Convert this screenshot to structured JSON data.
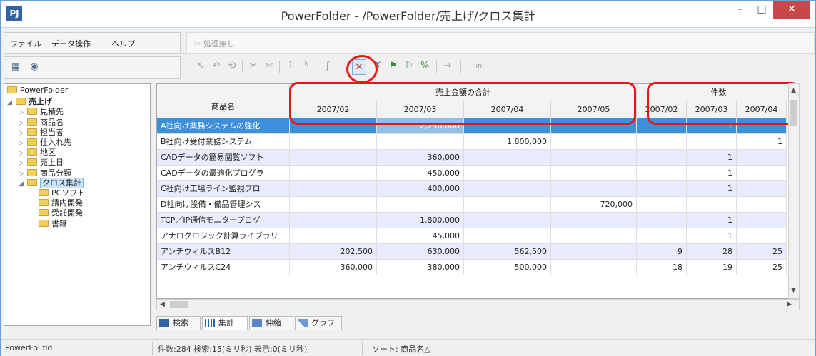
{
  "window": {
    "app_icon": "PJ",
    "title": "PowerFolder - /PowerFolder/売上げ/クロス集計",
    "min_glyph": "–",
    "max_glyph": "□",
    "close_glyph": "✕"
  },
  "menu": {
    "items": [
      "ファイル",
      "データ操作",
      "ヘルプ"
    ],
    "command_label": "処理無し"
  },
  "toolbar": {
    "left_icons": [
      "view-grid-icon",
      "eye-icon"
    ],
    "right_label": "ini"
  },
  "tree": {
    "nodes": [
      {
        "label": "PowerFolder",
        "level": 0,
        "arrow": ""
      },
      {
        "label": "売上げ",
        "level": 0,
        "arrow": "expanded",
        "bold": true
      },
      {
        "label": "見積先",
        "level": 1,
        "arrow": "collapsed"
      },
      {
        "label": "商品名",
        "level": 1,
        "arrow": "collapsed"
      },
      {
        "label": "担当者",
        "level": 1,
        "arrow": "collapsed"
      },
      {
        "label": "仕入れ先",
        "level": 1,
        "arrow": "collapsed"
      },
      {
        "label": "地区",
        "level": 1,
        "arrow": "collapsed"
      },
      {
        "label": "売上日",
        "level": 1,
        "arrow": "collapsed"
      },
      {
        "label": "商品分類",
        "level": 1,
        "arrow": "collapsed"
      },
      {
        "label": "クロス集計",
        "level": 1,
        "arrow": "expanded",
        "selected": true
      },
      {
        "label": "PCソフト",
        "level": 2,
        "arrow": ""
      },
      {
        "label": "請内開発",
        "level": 2,
        "arrow": ""
      },
      {
        "label": "受託開発",
        "level": 2,
        "arrow": ""
      },
      {
        "label": "書籍",
        "level": 2,
        "arrow": ""
      }
    ]
  },
  "grid": {
    "row_header_title": "商品名",
    "group_headers": [
      "売上金額の合計",
      "件数"
    ],
    "month_headers": [
      "2007/02",
      "2007/03",
      "2007/04",
      "2007/05",
      "2007/02",
      "2007/03",
      "2007/04"
    ],
    "rows": [
      {
        "name": "A社向け業務システムの強化",
        "vals": [
          "",
          "2,250,000",
          "",
          "",
          "",
          "1",
          ""
        ]
      },
      {
        "name": "B社向け受付業務システム",
        "vals": [
          "",
          "",
          "1,800,000",
          "",
          "",
          "",
          "1"
        ]
      },
      {
        "name": "CADデータの簡易閲覧ソフト",
        "vals": [
          "",
          "360,000",
          "",
          "",
          "",
          "1",
          ""
        ]
      },
      {
        "name": "CADデータの最適化プログラ",
        "vals": [
          "",
          "450,000",
          "",
          "",
          "",
          "1",
          ""
        ]
      },
      {
        "name": "C社向け工場ライン監視プロ",
        "vals": [
          "",
          "400,000",
          "",
          "",
          "",
          "1",
          ""
        ]
      },
      {
        "name": "D社向け設備・備品管理シス",
        "vals": [
          "",
          "",
          "",
          "720,000",
          "",
          "",
          ""
        ]
      },
      {
        "name": "TCP／IP通信モニタープログ",
        "vals": [
          "",
          "1,800,000",
          "",
          "",
          "",
          "1",
          ""
        ]
      },
      {
        "name": "アナログロジック計算ライブラリ",
        "vals": [
          "",
          "45,000",
          "",
          "",
          "",
          "1",
          ""
        ]
      },
      {
        "name": "アンチウィルスB12",
        "vals": [
          "202,500",
          "630,000",
          "562,500",
          "",
          "9",
          "28",
          "25"
        ]
      },
      {
        "name": "アンチウィルスC24",
        "vals": [
          "360,000",
          "380,000",
          "500,000",
          "",
          "18",
          "19",
          "25"
        ]
      }
    ]
  },
  "tabs": [
    "検索",
    "集計",
    "伸縮",
    "グラフ"
  ],
  "status": {
    "file": "PowerFol.fld",
    "counts": "件数:284  検索:15(ミリ秒)  表示:0(ミリ秒)",
    "sort": "ソート: 商品名△"
  },
  "colors": {
    "selected_row": "#3c8fdc",
    "alt_row": "#e8ebfb",
    "highlight": "#e01818"
  }
}
